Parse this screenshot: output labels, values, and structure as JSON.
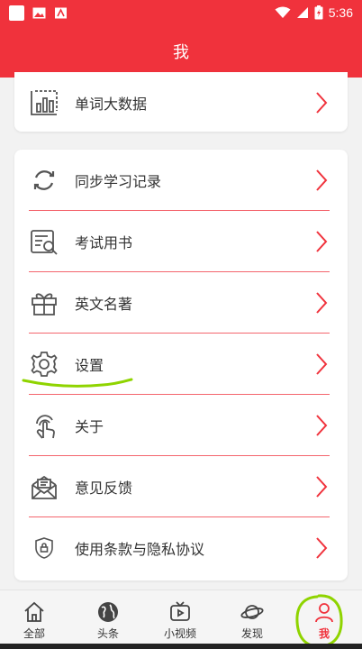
{
  "status_bar": {
    "time": "5:36"
  },
  "header": {
    "title": "我"
  },
  "top_card": {
    "item": {
      "label": "单词大数据",
      "icon": "chart-icon"
    }
  },
  "menu": {
    "items": [
      {
        "label": "同步学习记录",
        "icon": "sync-icon"
      },
      {
        "label": "考试用书",
        "icon": "exam-book-icon"
      },
      {
        "label": "英文名著",
        "icon": "gift-icon"
      },
      {
        "label": "设置",
        "icon": "gear-icon"
      },
      {
        "label": "关于",
        "icon": "touch-icon"
      },
      {
        "label": "意见反馈",
        "icon": "mail-icon"
      },
      {
        "label": "使用条款与隐私协议",
        "icon": "shield-icon"
      }
    ]
  },
  "tabbar": {
    "tabs": [
      {
        "label": "全部",
        "icon": "home-icon"
      },
      {
        "label": "头条",
        "icon": "globe-icon"
      },
      {
        "label": "小视频",
        "icon": "tv-icon"
      },
      {
        "label": "发现",
        "icon": "planet-icon"
      },
      {
        "label": "我",
        "icon": "person-icon",
        "active": true
      }
    ]
  },
  "colors": {
    "accent": "#f0323c",
    "annotation": "#8fd400"
  }
}
